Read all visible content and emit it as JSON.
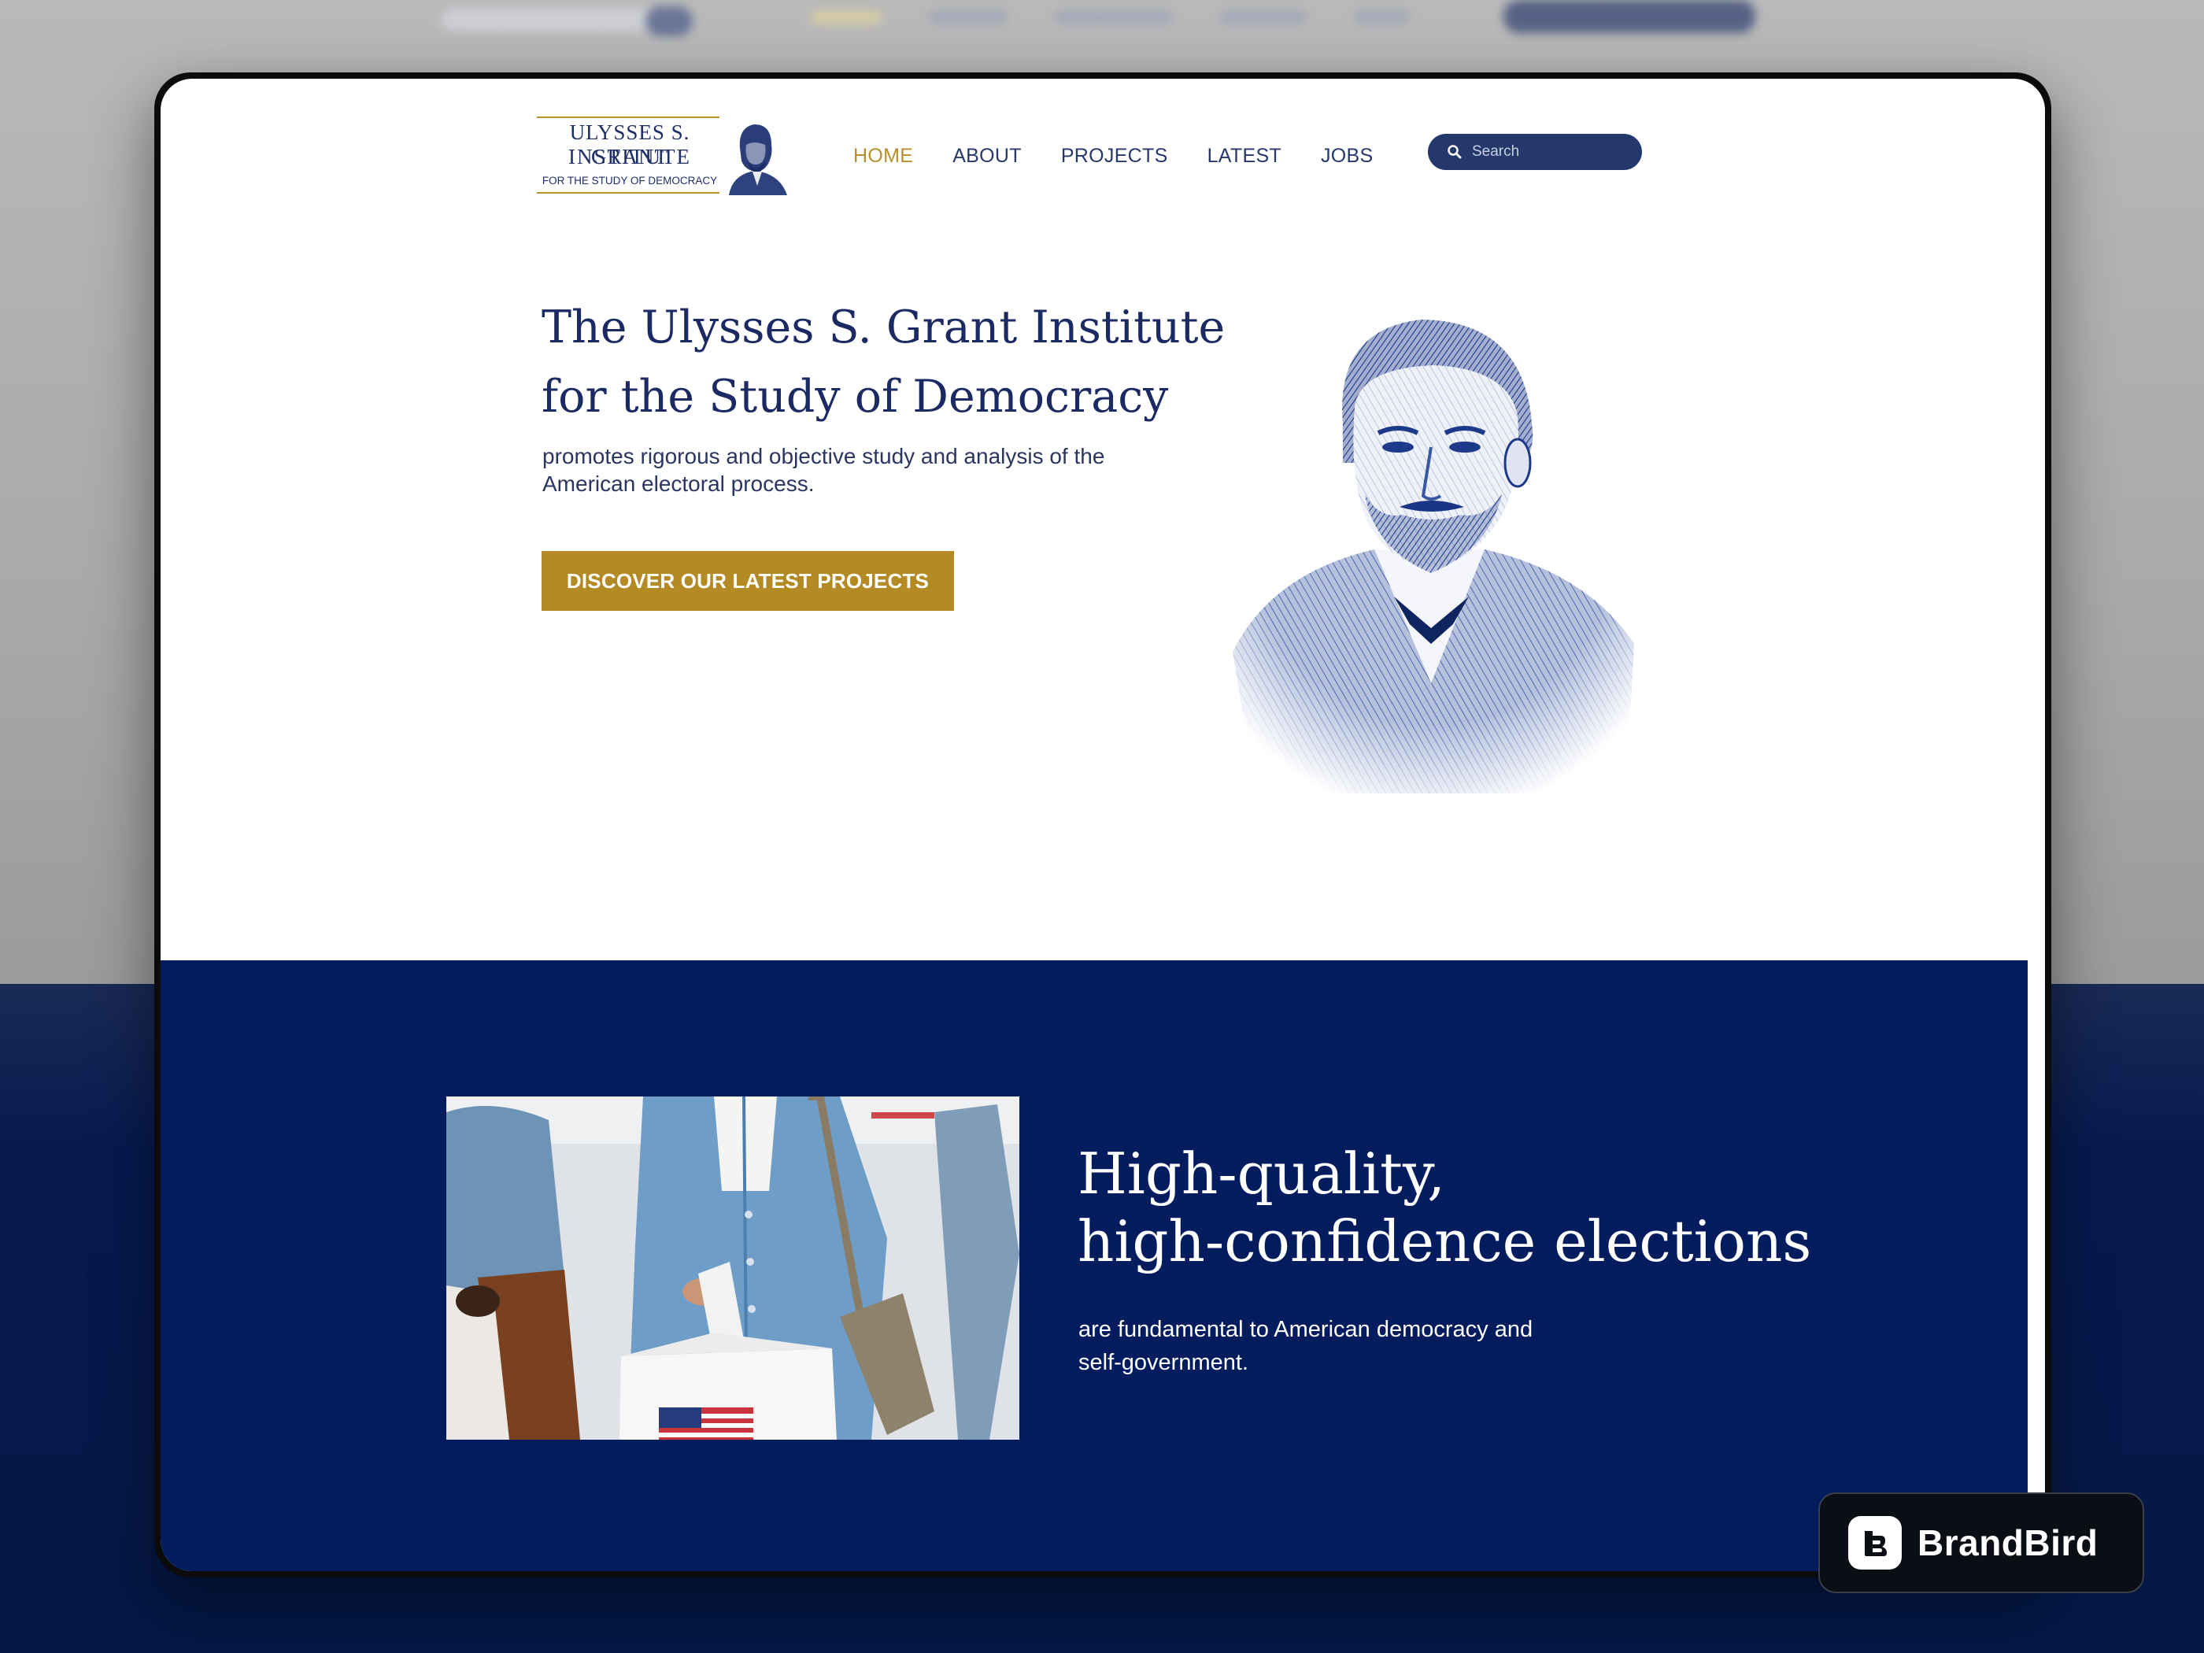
{
  "header": {
    "logo": {
      "line1": "ULYSSES S. GRANT",
      "line2": "INSTITUTE",
      "line3": "FOR THE STUDY OF DEMOCRACY"
    },
    "nav": [
      {
        "label": "HOME",
        "active": true
      },
      {
        "label": "ABOUT"
      },
      {
        "label": "PROJECTS"
      },
      {
        "label": "LATEST"
      },
      {
        "label": "JOBS"
      }
    ],
    "search": {
      "placeholder": "Search"
    }
  },
  "hero": {
    "title_line1": "The Ulysses S. Grant Institute",
    "title_line2": "for the Study of Democracy",
    "subtitle_line1": "promotes rigorous and objective study and analysis of the",
    "subtitle_line2": "American electoral process.",
    "cta_label": "DISCOVER OUR LATEST PROJECTS"
  },
  "feature": {
    "title_line1": "High-quality,",
    "title_line2": "high-confidence elections",
    "subtitle_line1": "are fundamental to American democracy and",
    "subtitle_line2": "self-government."
  },
  "badge": {
    "label": "BrandBird"
  },
  "colors": {
    "navy": "#031c5e",
    "gold": "#b38a24",
    "text_navy": "#1b2a63",
    "search_bg": "#24386c"
  },
  "icons": {
    "search": "search-icon",
    "brandbird": "brandbird-logo-icon"
  }
}
